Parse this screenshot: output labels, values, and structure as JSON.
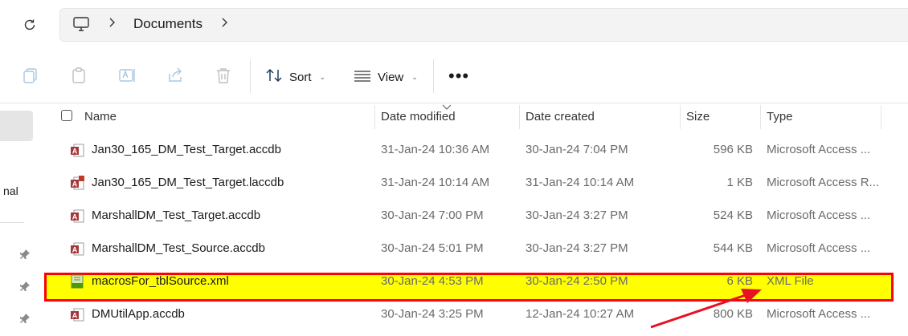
{
  "address_bar": {
    "breadcrumb": "Documents",
    "root_icon": "monitor-icon",
    "refresh_icon": "refresh-icon"
  },
  "toolbar": {
    "copy_icon": "copy-icon",
    "paste_icon": "paste-icon",
    "rename_icon": "rename-icon",
    "share_icon": "share-icon",
    "delete_icon": "trash-icon",
    "sort_label": "Sort",
    "view_label": "View",
    "more_label": "•••"
  },
  "nav": {
    "partial_label": "nal"
  },
  "columns": {
    "name": "Name",
    "date_modified": "Date modified",
    "date_created": "Date created",
    "size": "Size",
    "type": "Type"
  },
  "files": [
    {
      "name": "Jan30_165_DM_Test_Target.accdb",
      "modified": "31-Jan-24 10:36 AM",
      "created": "30-Jan-24 7:04 PM",
      "size": "596 KB",
      "type": "Microsoft Access ...",
      "icon": "access-db-icon"
    },
    {
      "name": "Jan30_165_DM_Test_Target.laccdb",
      "modified": "31-Jan-24 10:14 AM",
      "created": "31-Jan-24 10:14 AM",
      "size": "1 KB",
      "type": "Microsoft Access R...",
      "icon": "access-lock-icon"
    },
    {
      "name": "MarshallDM_Test_Target.accdb",
      "modified": "30-Jan-24 7:00 PM",
      "created": "30-Jan-24 3:27 PM",
      "size": "524 KB",
      "type": "Microsoft Access ...",
      "icon": "access-db-icon"
    },
    {
      "name": "MarshallDM_Test_Source.accdb",
      "modified": "30-Jan-24 5:01 PM",
      "created": "30-Jan-24 3:27 PM",
      "size": "544 KB",
      "type": "Microsoft Access ...",
      "icon": "access-db-icon"
    },
    {
      "name": "macrosFor_tblSource.xml",
      "modified": "30-Jan-24 4:53 PM",
      "created": "30-Jan-24 2:50 PM",
      "size": "6 KB",
      "type": "XML File",
      "icon": "xml-file-icon"
    },
    {
      "name": "DMUtilApp.accdb",
      "modified": "30-Jan-24 3:25 PM",
      "created": "12-Jan-24 10:27 AM",
      "size": "800 KB",
      "type": "Microsoft Access ...",
      "icon": "access-db-icon"
    }
  ],
  "colors": {
    "highlight_fill": "#ffff00",
    "highlight_border": "#ff0000",
    "annotation_arrow": "#e81123",
    "access_red": "#a4373a",
    "xml_green": "#4e9a06"
  }
}
